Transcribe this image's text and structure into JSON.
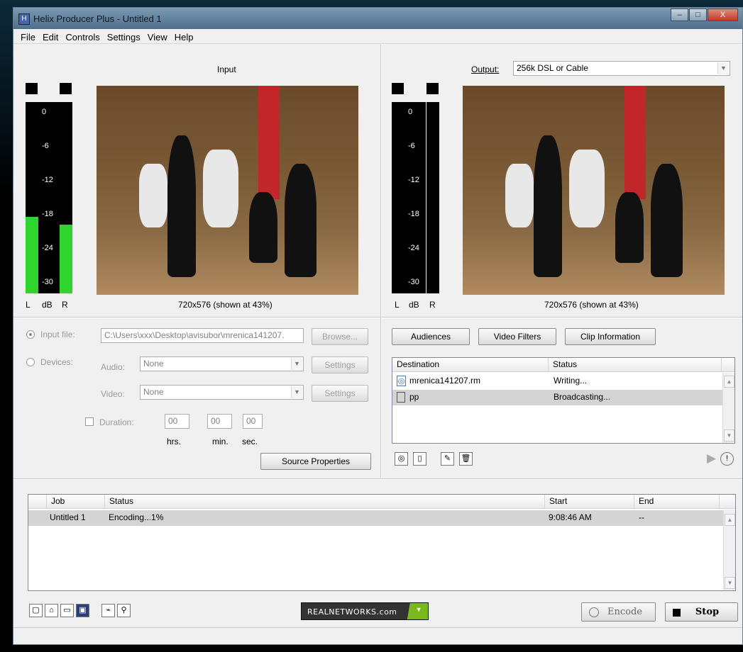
{
  "window": {
    "title": "Helix Producer Plus - Untitled 1",
    "min": "–",
    "max": "□",
    "close": "X"
  },
  "menu": [
    "File",
    "Edit",
    "Controls",
    "Settings",
    "View",
    "Help"
  ],
  "input": {
    "heading": "Input",
    "scale": [
      "0",
      "-6",
      "-12",
      "-18",
      "-24",
      "-30"
    ],
    "meter_labels": {
      "l": "L",
      "db": "dB",
      "r": "R"
    },
    "resolution": "720x576 (shown at 43%)",
    "level_left": 0.4,
    "level_right": 0.36
  },
  "output": {
    "label": "Output:",
    "preset": "256k DSL or Cable",
    "scale": [
      "0",
      "-6",
      "-12",
      "-18",
      "-24",
      "-30"
    ],
    "meter_labels": {
      "l": "L",
      "db": "dB",
      "r": "R"
    },
    "resolution": "720x576 (shown at 43%)"
  },
  "source": {
    "input_file_label": "Input file:",
    "input_file_value": "C:\\Users\\xxx\\Desktop\\avisubor\\mrenica141207.",
    "browse": "Browse...",
    "devices_label": "Devices:",
    "audio_label": "Audio:",
    "audio_value": "None",
    "video_label": "Video:",
    "video_value": "None",
    "settings": "Settings",
    "duration_label": "Duration:",
    "hh": "00",
    "mm": "00",
    "ss": "00",
    "hrs": "hrs.",
    "min": "min.",
    "sec": "sec.",
    "source_properties": "Source Properties"
  },
  "output_buttons": {
    "audiences": "Audiences",
    "video_filters": "Video Filters",
    "clip_info": "Clip Information"
  },
  "destinations": {
    "headers": [
      "Destination",
      "Status"
    ],
    "rows": [
      {
        "name": "mrenica141207.rm",
        "status": "Writing..."
      },
      {
        "name": "pp",
        "status": "Broadcasting..."
      }
    ]
  },
  "jobs": {
    "headers": [
      "Job",
      "Status",
      "Start",
      "End"
    ],
    "rows": [
      {
        "job": "Untitled 1",
        "status": "Encoding...1%",
        "start": "9:08:46 AM",
        "end": "--"
      }
    ]
  },
  "bottom": {
    "realnetworks": "REALNETWORKS.com",
    "encode": "Encode",
    "stop": "Stop"
  },
  "colors": {
    "meter_green": "#2fd42f",
    "curtain_red": "#c0262a"
  }
}
